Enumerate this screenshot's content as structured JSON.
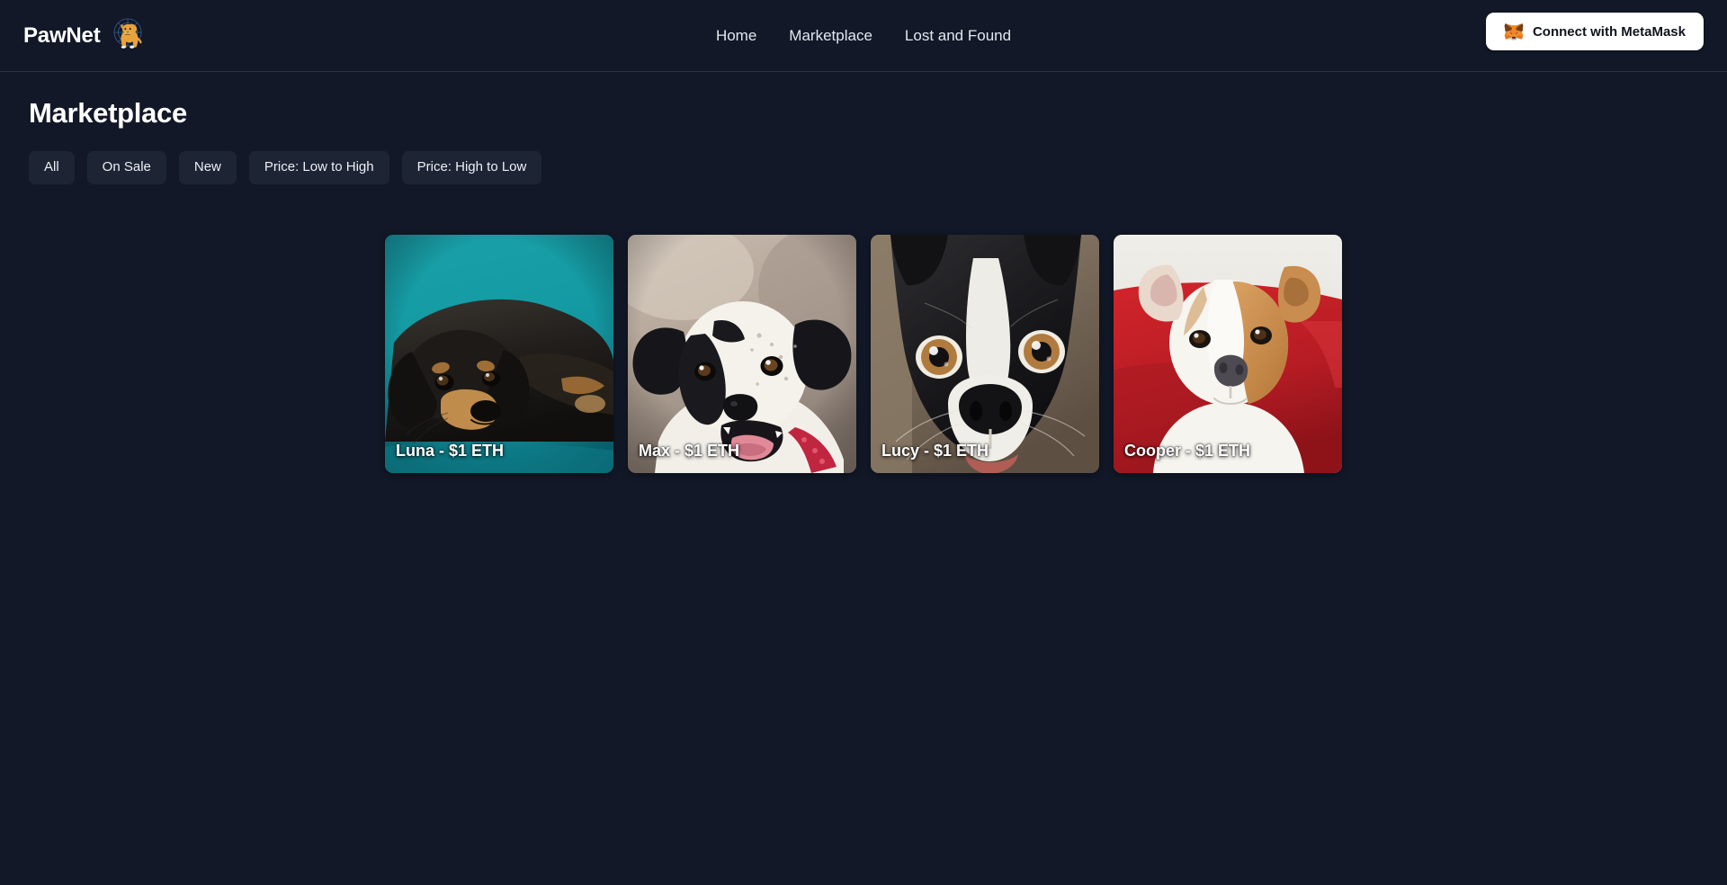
{
  "header": {
    "brand_name": "PawNet",
    "logo_icon": "dog-network-logo",
    "nav": [
      {
        "label": "Home",
        "name": "home"
      },
      {
        "label": "Marketplace",
        "name": "marketplace"
      },
      {
        "label": "Lost and Found",
        "name": "lost-and-found"
      }
    ],
    "connect_button": {
      "label": "Connect with MetaMask",
      "icon": "metamask-fox-icon"
    }
  },
  "main": {
    "title": "Marketplace",
    "filters": [
      {
        "label": "All"
      },
      {
        "label": "On Sale"
      },
      {
        "label": "New"
      },
      {
        "label": "Price: Low to High"
      },
      {
        "label": "Price: High to Low"
      }
    ],
    "cards": [
      {
        "label": "Luna - $1 ETH",
        "name": "Luna",
        "price": "$1 ETH",
        "image": "black-and-tan-dachshund-on-teal-blanket"
      },
      {
        "label": "Max - $1 ETH",
        "name": "Max",
        "price": "$1 ETH",
        "image": "black-and-white-terrier-with-red-collar"
      },
      {
        "label": "Lucy - $1 ETH",
        "name": "Lucy",
        "price": "$1 ETH",
        "image": "boston-terrier-face-closeup"
      },
      {
        "label": "Cooper - $1 ETH",
        "name": "Cooper",
        "price": "$1 ETH",
        "image": "tan-and-white-terrier-on-red-couch"
      }
    ]
  },
  "colors": {
    "background": "#121827",
    "chip_background": "#1d2433",
    "divider": "#2a3347",
    "accent_white": "#ffffff",
    "metamask_orange": "#e2761b"
  }
}
